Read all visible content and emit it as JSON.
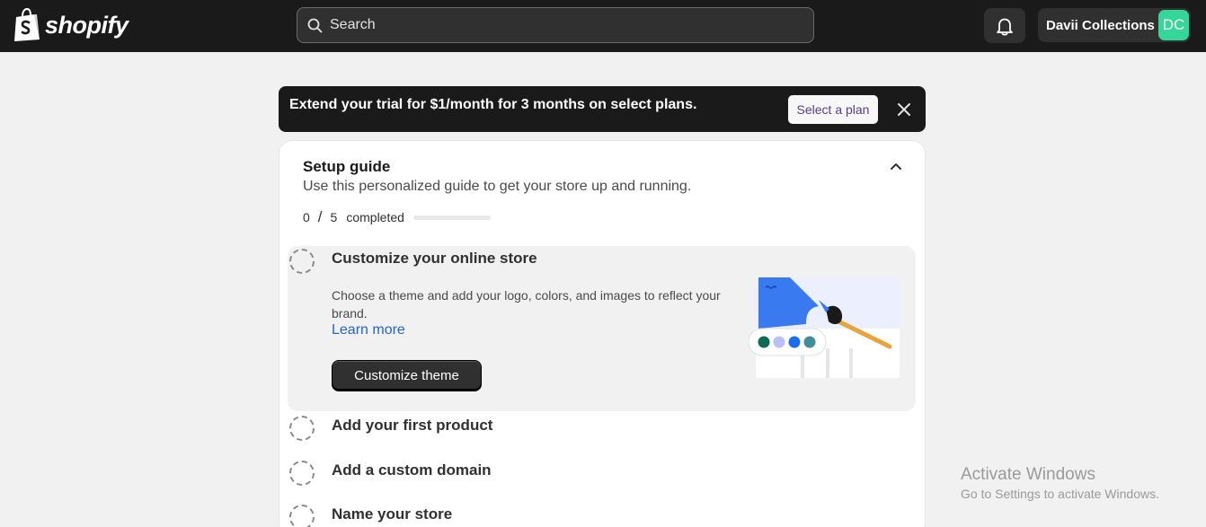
{
  "topbar": {
    "brand": "shopify",
    "search_placeholder": "Search",
    "store_name": "Davii Collections",
    "avatar_initials": "DC",
    "avatar_color": "#35d69a"
  },
  "banner": {
    "text": "Extend your trial for $1/month for 3 months on select plans.",
    "button_label": "Select a plan"
  },
  "setup_guide": {
    "title": "Setup guide",
    "subtitle": "Use this personalized guide to get your store up and running.",
    "completed_count": "0",
    "slash": "/",
    "total_count": "5",
    "completed_label": "completed",
    "progress_fraction": 0,
    "active_task": {
      "title": "Customize your online store",
      "description": "Choose a theme and add your logo, colors, and images to reflect your brand.",
      "link_label": "Learn more",
      "button_label": "Customize theme",
      "swatch_colors": [
        "#0b6b55",
        "#b8c0f5",
        "#1a6cf0",
        "#3f8e98"
      ]
    },
    "tasks": [
      {
        "title": "Add your first product"
      },
      {
        "title": "Add a custom domain"
      },
      {
        "title": "Name your store"
      }
    ]
  },
  "watermark": {
    "line1": "Activate Windows",
    "line2": "Go to Settings to activate Windows."
  }
}
